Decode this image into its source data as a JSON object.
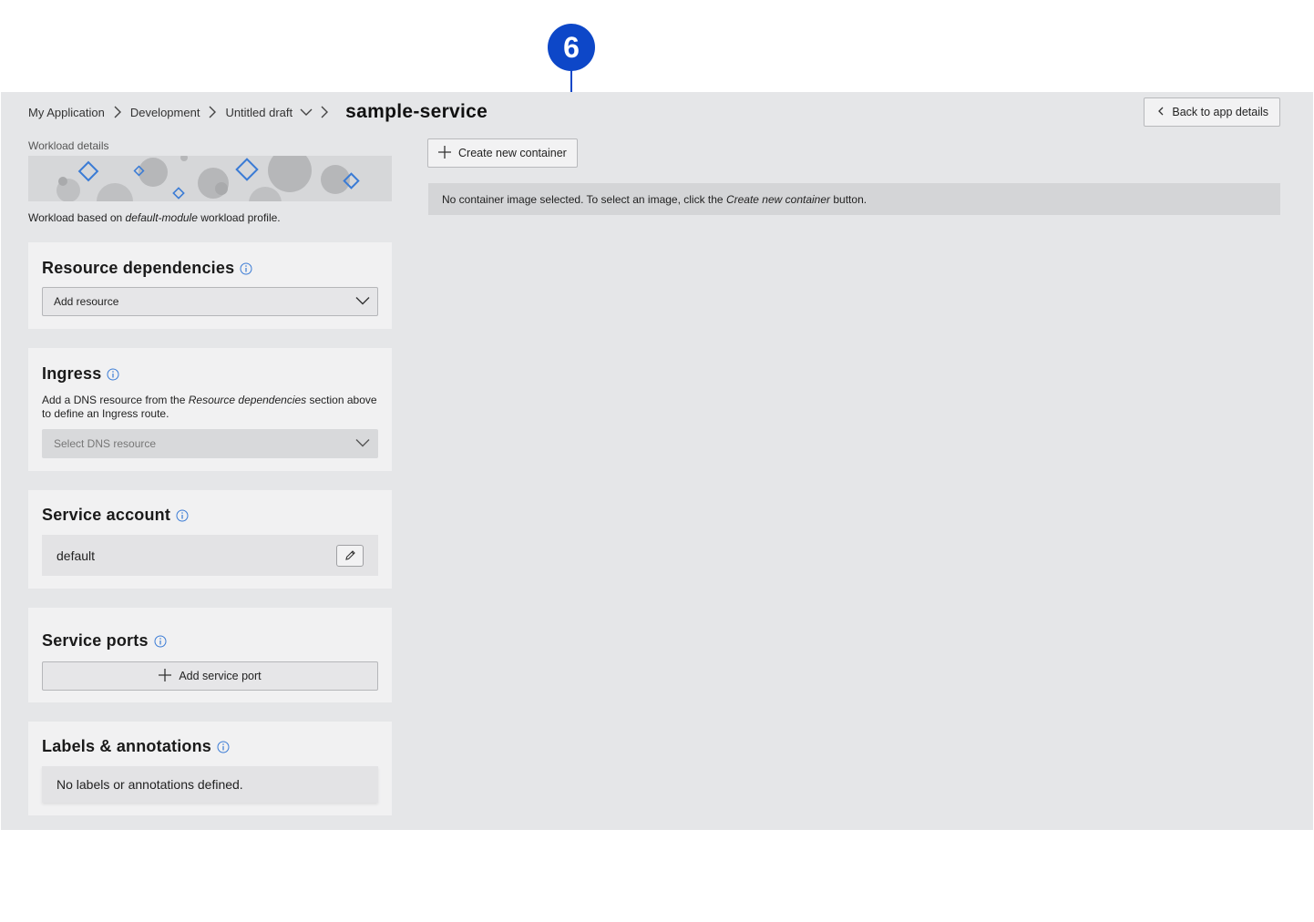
{
  "callout": {
    "number": "6",
    "color": "#0d47c8"
  },
  "breadcrumb": {
    "items": [
      "My Application",
      "Development",
      "Untitled draft"
    ],
    "current": "sample-service"
  },
  "header": {
    "back_button": "Back to app details"
  },
  "workload": {
    "section_label": "Workload details",
    "desc_prefix": "Workload based on ",
    "profile_name": "default-module",
    "desc_suffix": " workload profile."
  },
  "panels": {
    "resource_dependencies": {
      "title": "Resource dependencies",
      "select_placeholder": "Add resource"
    },
    "ingress": {
      "title": "Ingress",
      "desc_prefix": "Add a DNS resource from the ",
      "desc_link": "Resource dependencies",
      "desc_suffix": " section above to define an Ingress route.",
      "select_placeholder": "Select DNS resource"
    },
    "service_account": {
      "title": "Service account",
      "value": "default"
    },
    "service_ports": {
      "title": "Service ports",
      "add_button": "Add service port"
    },
    "labels": {
      "title": "Labels & annotations",
      "empty_text": "No labels or annotations defined."
    }
  },
  "main": {
    "create_button": "Create new container",
    "notice_prefix": "No container image selected. To select an image, click the ",
    "notice_emph": "Create new container",
    "notice_suffix": " button."
  },
  "colors": {
    "accent": "#3a7bd5",
    "background": "#e5e6e8",
    "panel": "#f1f1f2"
  }
}
